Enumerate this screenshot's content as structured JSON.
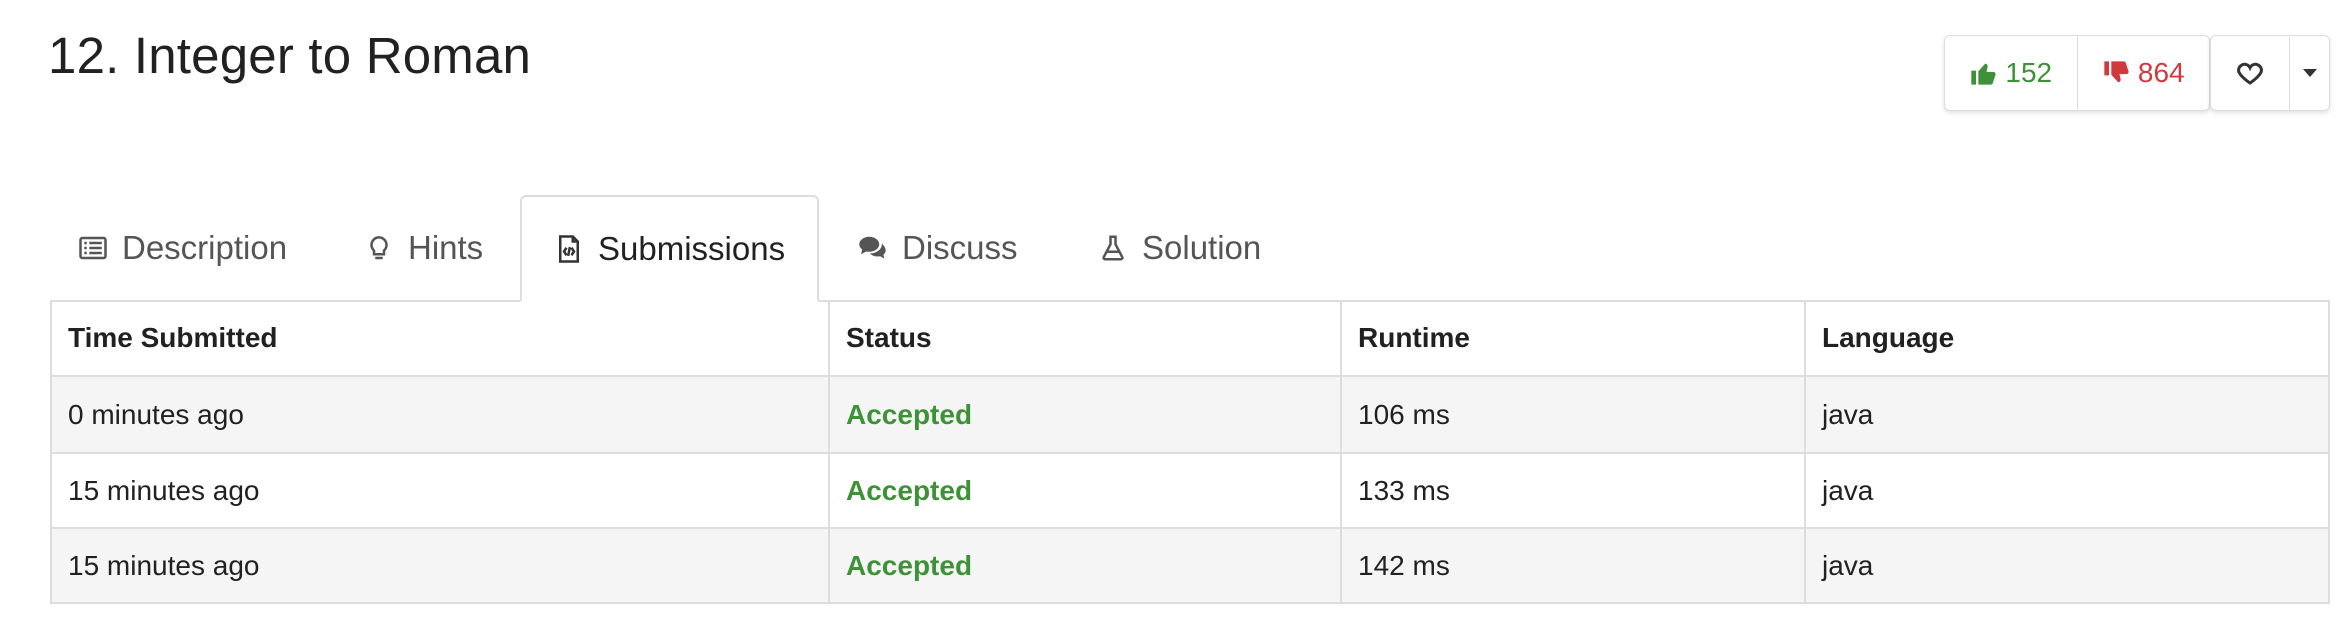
{
  "problem": {
    "title": "12. Integer to Roman"
  },
  "votes": {
    "likes": "152",
    "dislikes": "864",
    "like_color": "#3d9237",
    "dislike_color": "#d0393e"
  },
  "favorite": {
    "icon": "heart-outline-icon",
    "caret_icon": "caret-down-icon"
  },
  "tabs": [
    {
      "label": "Description",
      "icon": "list-icon",
      "active": false
    },
    {
      "label": "Hints",
      "icon": "lightbulb-icon",
      "active": false
    },
    {
      "label": "Submissions",
      "icon": "code-file-icon",
      "active": true
    },
    {
      "label": "Discuss",
      "icon": "comments-icon",
      "active": false
    },
    {
      "label": "Solution",
      "icon": "flask-icon",
      "active": false
    }
  ],
  "table": {
    "columns": [
      "Time Submitted",
      "Status",
      "Runtime",
      "Language"
    ],
    "rows": [
      {
        "time": "0 minutes ago",
        "status": "Accepted",
        "runtime": "106 ms",
        "language": "java"
      },
      {
        "time": "15 minutes ago",
        "status": "Accepted",
        "runtime": "133 ms",
        "language": "java"
      },
      {
        "time": "15 minutes ago",
        "status": "Accepted",
        "runtime": "142 ms",
        "language": "java"
      }
    ],
    "accepted_color": "#3d9237"
  }
}
